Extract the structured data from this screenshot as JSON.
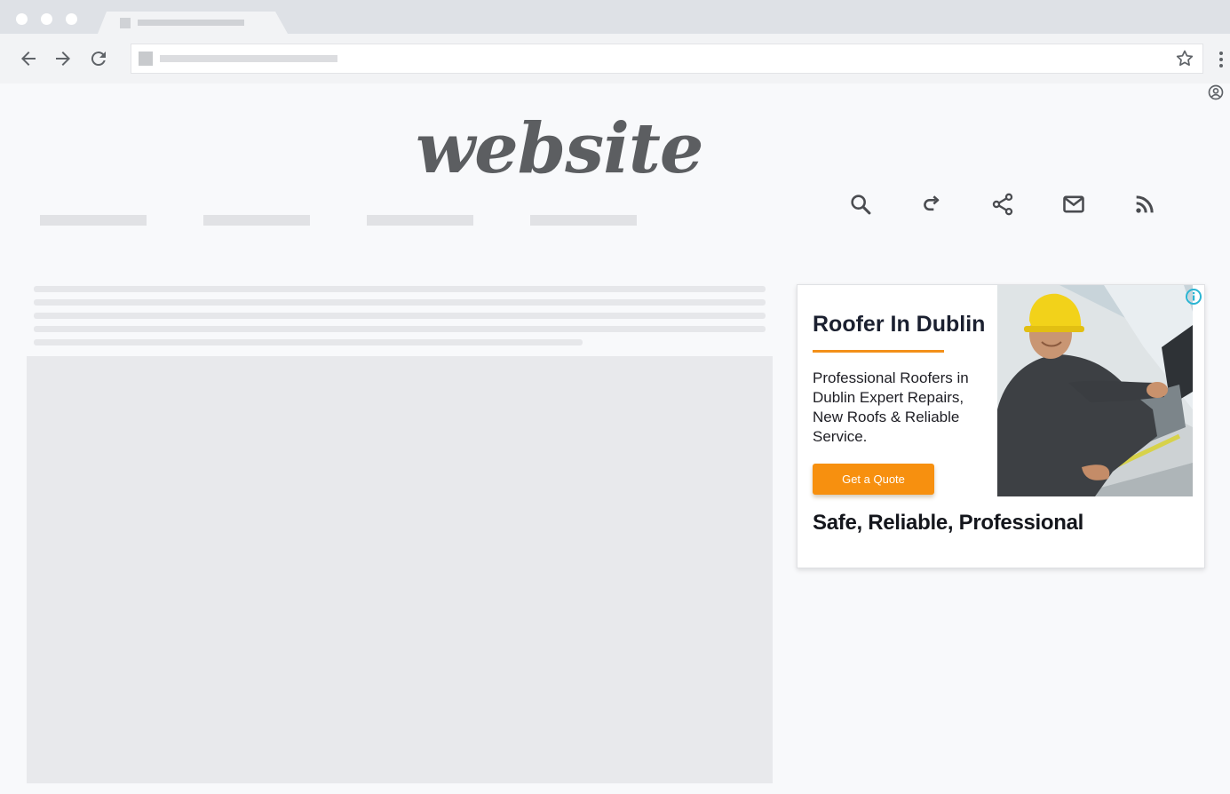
{
  "site": {
    "logo_text": "website"
  },
  "toolbar_icons": [
    "back-arrow-icon",
    "forward-arrow-icon",
    "reload-icon",
    "star-icon",
    "more-vert-icon",
    "account-circle-icon"
  ],
  "actions": [
    "search-icon",
    "redo-icon",
    "share-icon",
    "mail-icon",
    "rss-icon"
  ],
  "ad": {
    "title": "Roofer In Dublin",
    "description": "Professional Roofers in Dublin Expert Repairs, New Roofs & Reliable Service.",
    "button_label": "Get a Quote",
    "tagline": "Safe, Reliable, Professional",
    "image": "roofer-worker-photo",
    "info_icon": "info-icon",
    "accent_color": "#f7900f",
    "info_color": "#2bb5d3"
  }
}
